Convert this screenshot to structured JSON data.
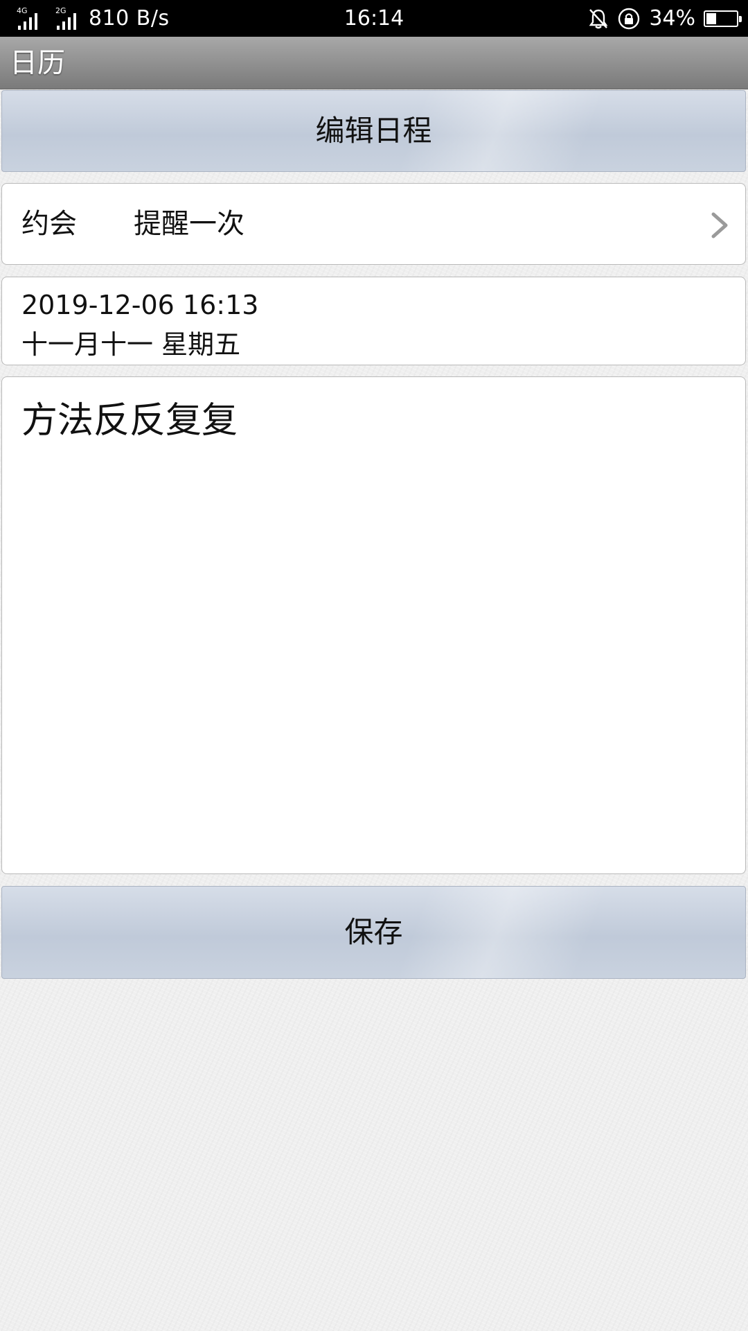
{
  "status_bar": {
    "network_1": "4G",
    "network_2": "2G",
    "speed": "810 B/s",
    "time": "16:14",
    "battery_percent": "34%",
    "battery_level": 0.34,
    "icons": [
      "signal-icon",
      "signal-icon",
      "alarm-off-icon",
      "rotation-lock-icon",
      "battery-icon"
    ]
  },
  "app": {
    "title": "日历"
  },
  "header": {
    "title": "编辑日程"
  },
  "event": {
    "type": "约会",
    "reminder": "提醒一次",
    "datetime": "2019-12-06 16:13",
    "lunar_date": "十一月十一 星期五",
    "note": "方法反反复复"
  },
  "actions": {
    "save_label": "保存"
  }
}
